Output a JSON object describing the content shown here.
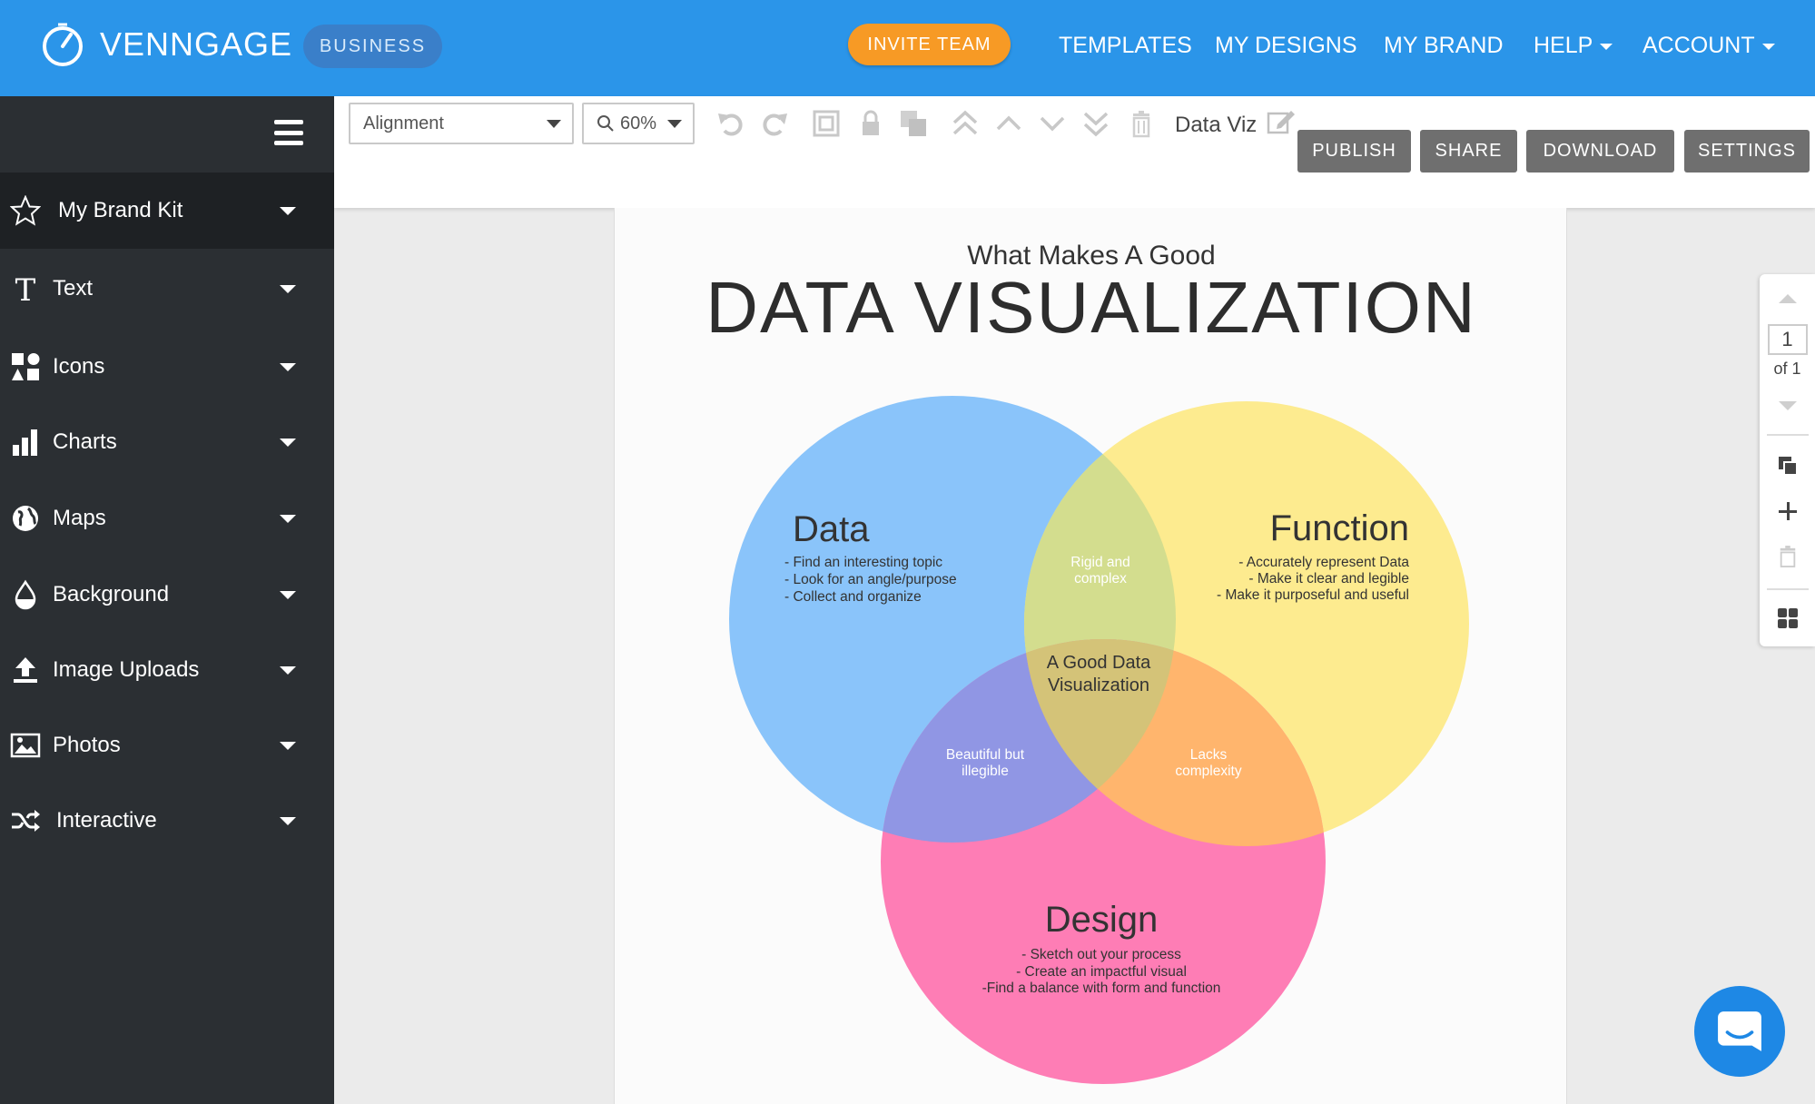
{
  "header": {
    "brand": "VENNGAGE",
    "plan": "BUSINESS",
    "invite_label": "INVITE TEAM",
    "nav": [
      {
        "label": "TEMPLATES"
      },
      {
        "label": "MY DESIGNS"
      },
      {
        "label": "MY BRAND"
      },
      {
        "label": "HELP"
      },
      {
        "label": "ACCOUNT"
      }
    ]
  },
  "sidebar": {
    "items": [
      {
        "label": "My Brand Kit",
        "icon": "star-icon"
      },
      {
        "label": "Text",
        "icon": "text-icon"
      },
      {
        "label": "Icons",
        "icon": "shapes-icon"
      },
      {
        "label": "Charts",
        "icon": "bar-chart-icon"
      },
      {
        "label": "Maps",
        "icon": "globe-icon"
      },
      {
        "label": "Background",
        "icon": "droplet-icon"
      },
      {
        "label": "Image Uploads",
        "icon": "upload-icon"
      },
      {
        "label": "Photos",
        "icon": "image-icon"
      },
      {
        "label": "Interactive",
        "icon": "shuffle-icon"
      }
    ]
  },
  "toolbar": {
    "alignment_value": "Alignment",
    "zoom_value": "60%",
    "doc_title": "Data Viz",
    "buttons": {
      "publish": "PUBLISH",
      "share": "SHARE",
      "download": "DOWNLOAD",
      "settings": "SETTINGS"
    }
  },
  "infographic": {
    "subtitle": "What Makes A Good",
    "title": "DATA VISUALIZATION",
    "circles": {
      "data": {
        "heading": "Data",
        "bullets": [
          "- Find an interesting topic",
          "- Look for an angle/purpose",
          "- Collect and organize"
        ],
        "color": "#8ac4fa"
      },
      "function": {
        "heading": "Function",
        "bullets": [
          "- Accurately represent Data",
          "- Make it clear and legible",
          "- Make it purposeful and useful"
        ],
        "color": "#fdeb8f"
      },
      "design": {
        "heading": "Design",
        "bullets": [
          "- Sketch out your process",
          "- Create an impactful visual",
          "-Find a balance with form and function"
        ],
        "color": "#fe7db5"
      }
    },
    "overlaps": {
      "data_function": [
        "Rigid and",
        "complex"
      ],
      "data_design": [
        "Beautiful but",
        "illegible"
      ],
      "function_design": [
        "Lacks",
        "complexity"
      ],
      "center": [
        "A Good Data",
        "Visualization"
      ]
    }
  },
  "pages": {
    "current": "1",
    "total_label": "of 1"
  }
}
